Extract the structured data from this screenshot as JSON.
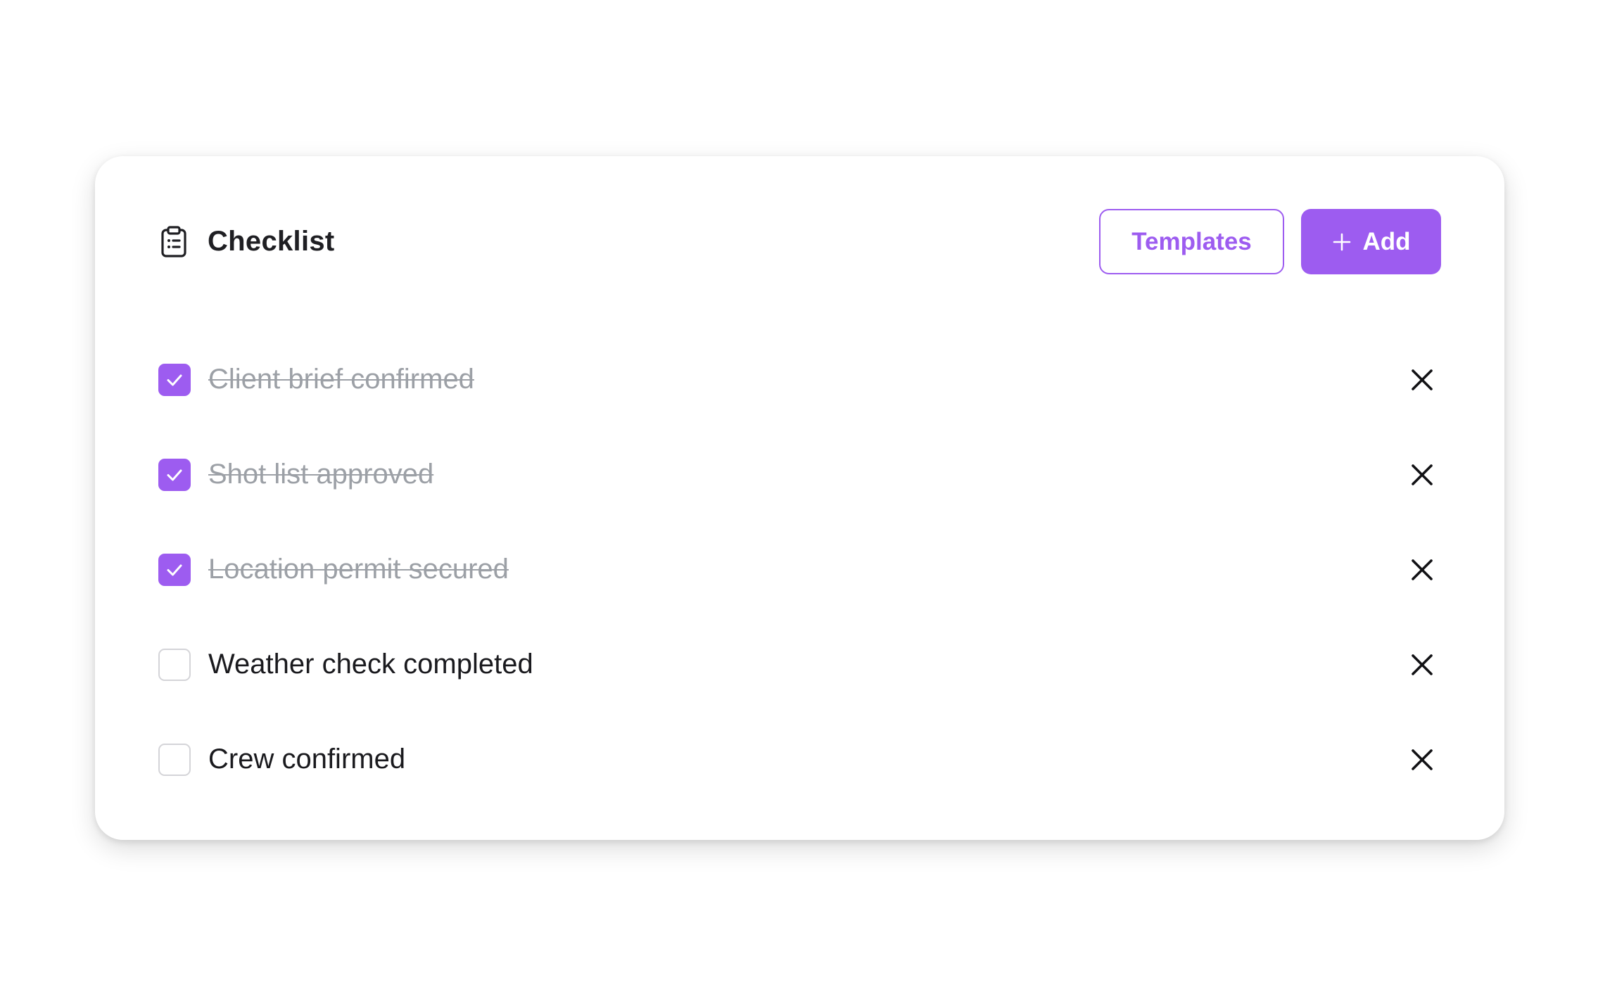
{
  "checklist": {
    "title": "Checklist",
    "title_icon": "clipboard-list-icon",
    "templates_label": "Templates",
    "add_label": "Add",
    "add_icon": "plus-icon",
    "remove_icon": "close-icon",
    "accent_color": "#9d5cf0",
    "items": [
      {
        "label": "Client brief confirmed",
        "checked": true
      },
      {
        "label": "Shot list approved",
        "checked": true
      },
      {
        "label": "Location permit secured",
        "checked": true
      },
      {
        "label": "Weather check completed",
        "checked": false
      },
      {
        "label": "Crew confirmed",
        "checked": false
      }
    ]
  }
}
